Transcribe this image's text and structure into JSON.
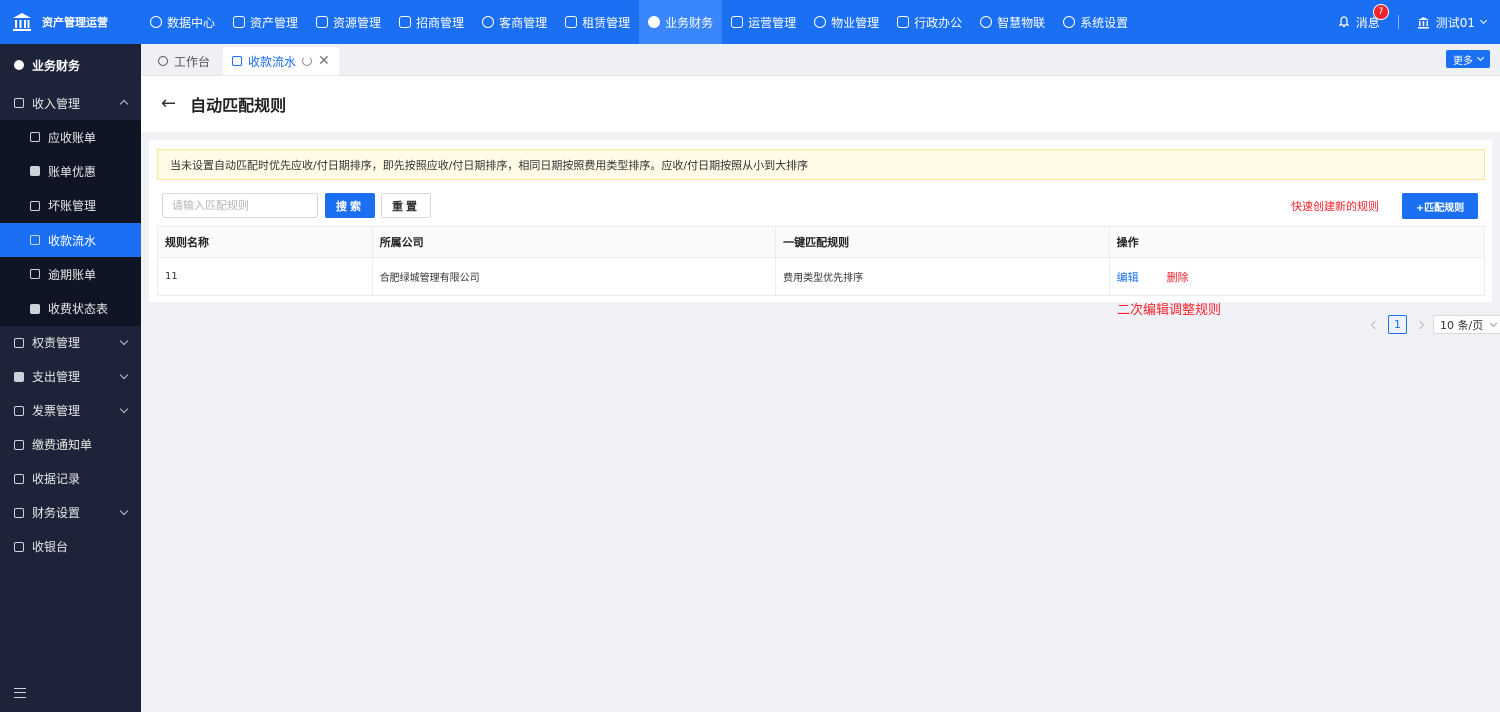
{
  "brand": {
    "title": "资产管理运营"
  },
  "nav": [
    {
      "label": "数据中心",
      "icon": "dashboard-icon"
    },
    {
      "label": "资产管理",
      "icon": "cube-icon"
    },
    {
      "label": "资源管理",
      "icon": "building-icon"
    },
    {
      "label": "招商管理",
      "icon": "tag-icon"
    },
    {
      "label": "客商管理",
      "icon": "users-icon"
    },
    {
      "label": "租赁管理",
      "icon": "house-icon"
    },
    {
      "label": "业务财务",
      "icon": "finance-icon",
      "active": true
    },
    {
      "label": "运营管理",
      "icon": "operation-icon"
    },
    {
      "label": "物业管理",
      "icon": "property-icon"
    },
    {
      "label": "行政办公",
      "icon": "office-icon"
    },
    {
      "label": "智慧物联",
      "icon": "iot-icon"
    },
    {
      "label": "系统设置",
      "icon": "gear-icon"
    }
  ],
  "topright": {
    "messages": "消息",
    "badge": "7",
    "user": "测试01"
  },
  "sidebar": {
    "header": "业务财务",
    "income_group": "收入管理",
    "income_items": [
      {
        "label": "应收账单"
      },
      {
        "label": "账单优惠"
      },
      {
        "label": "坏账管理"
      },
      {
        "label": "收款流水",
        "active": true
      },
      {
        "label": "逾期账单"
      },
      {
        "label": "收费状态表"
      }
    ],
    "groups": [
      {
        "label": "权责管理",
        "chevron": true
      },
      {
        "label": "支出管理",
        "chevron": true
      },
      {
        "label": "发票管理",
        "chevron": true
      },
      {
        "label": "缴费通知单",
        "chevron": false
      },
      {
        "label": "收据记录",
        "chevron": false
      },
      {
        "label": "财务设置",
        "chevron": true
      },
      {
        "label": "收银台",
        "chevron": false
      }
    ]
  },
  "tabs": {
    "workbench": "工作台",
    "active": "收款流水",
    "more": "更多"
  },
  "page": {
    "title": "自动匹配规则"
  },
  "notice": "当未设置自动匹配时优先应收/付日期排序，即先按照应收/付日期排序，相同日期按照费用类型排序。应收/付日期按照从小到大排序",
  "search": {
    "placeholder": "请输入匹配规则",
    "value": "",
    "search_btn": "搜索",
    "reset_btn": "重置"
  },
  "annotations": {
    "create": "快速创建新的规则",
    "edit": "二次编辑调整规则"
  },
  "add_btn": "+匹配规则",
  "table": {
    "headers": [
      "规则名称",
      "所属公司",
      "一键匹配规则",
      "操作"
    ],
    "rows": [
      {
        "name": "11",
        "company": "合肥绿城管理有限公司",
        "rule": "费用类型优先排序",
        "edit": "编辑",
        "delete": "删除"
      }
    ]
  },
  "pagination": {
    "page": "1",
    "page_size": "10 条/页"
  }
}
